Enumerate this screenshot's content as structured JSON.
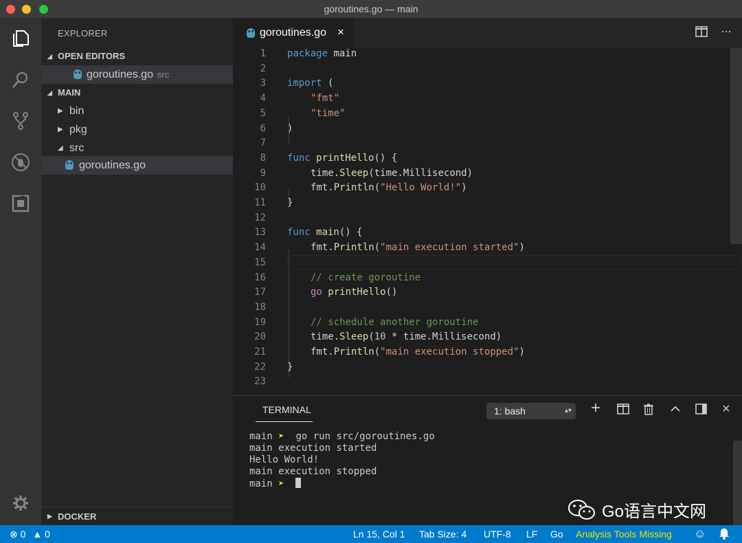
{
  "window": {
    "title": "goroutines.go — main"
  },
  "sidebar": {
    "header": "EXPLORER",
    "open_editors": {
      "label": "OPEN EDITORS",
      "items": [
        {
          "name": "goroutines.go",
          "dir": "src"
        }
      ]
    },
    "main": {
      "label": "MAIN",
      "items": [
        {
          "name": "bin"
        },
        {
          "name": "pkg"
        },
        {
          "name": "src"
        },
        {
          "name": "goroutines.go"
        }
      ]
    },
    "docker": {
      "label": "DOCKER"
    }
  },
  "editor": {
    "tab": {
      "label": "goroutines.go",
      "close": "×"
    },
    "actions": {
      "more": "···"
    },
    "line_numbers": [
      "1",
      "2",
      "3",
      "4",
      "5",
      "6",
      "7",
      "8",
      "9",
      "10",
      "11",
      "12",
      "13",
      "14",
      "15",
      "16",
      "17",
      "18",
      "19",
      "20",
      "21",
      "22",
      "23"
    ],
    "code": {
      "l1_kw": "package",
      "l1_rest": " main",
      "l3_kw": "import",
      "l3_rest": " (",
      "l4": "\"fmt\"",
      "l5": "\"time\"",
      "l6": ")",
      "l8_kw": "func",
      "l8_fn": " printHello",
      "l8_rest": "() {",
      "l9_a": "time.",
      "l9_fn": "Sleep",
      "l9_b": "(time.Millisecond)",
      "l10_a": "fmt.",
      "l10_fn": "Println",
      "l10_b": "(",
      "l10_str": "\"Hello World!\"",
      "l10_c": ")",
      "l11": "}",
      "l13_kw": "func",
      "l13_fn": " main",
      "l13_rest": "() {",
      "l14_a": "fmt.",
      "l14_fn": "Println",
      "l14_b": "(",
      "l14_str": "\"main execution started\"",
      "l14_c": ")",
      "l16": "// create goroutine",
      "l17_kw": "go",
      "l17_fn": " printHello",
      "l17_rest": "()",
      "l19": "// schedule another goroutine",
      "l20_a": "time.",
      "l20_fn": "Sleep",
      "l20_b": "(",
      "l20_num": "10",
      "l20_c": " * time.Millisecond)",
      "l21_a": "fmt.",
      "l21_fn": "Println",
      "l21_b": "(",
      "l21_str": "\"main execution stopped\"",
      "l21_c": ")",
      "l22": "}"
    }
  },
  "panel": {
    "tab": "TERMINAL",
    "select": {
      "value": "1: bash",
      "arrows": "▴▾"
    },
    "buttons": {
      "add": "+",
      "close": "×"
    },
    "terminal": {
      "prompt_dir": "main",
      "prompt_arrow": "➤",
      "command": "go run src/goroutines.go",
      "out1": "main execution started",
      "out2": "Hello World!",
      "out3": "main execution stopped"
    }
  },
  "watermark": {
    "text": "Go语言中文网"
  },
  "statusbar": {
    "errors": "0",
    "warnings": "0",
    "position": "Ln 15, Col 1",
    "tab_size": "Tab Size: 4",
    "encoding": "UTF-8",
    "eol": "LF",
    "language": "Go",
    "analysis": "Analysis Tools Missing"
  },
  "colors": {
    "statusbar": "#007acc",
    "keyword": "#569cd6",
    "string": "#ce9178",
    "function": "#dcdcaa",
    "comment": "#6a9955",
    "warning": "#e6e600"
  }
}
